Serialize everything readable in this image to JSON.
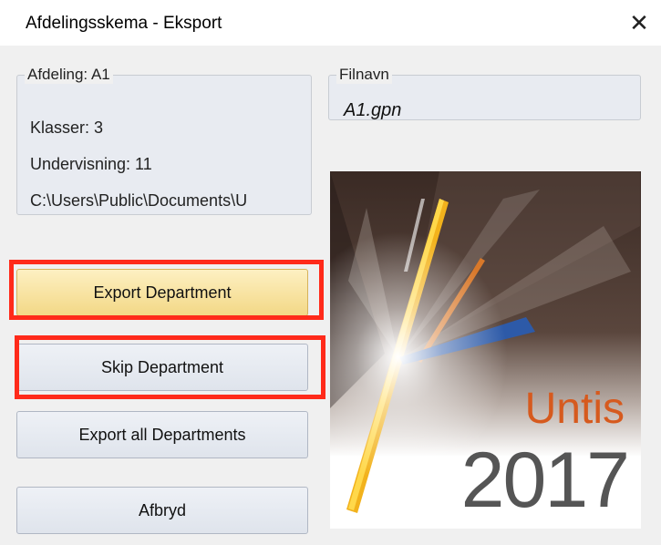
{
  "window": {
    "title": "Afdelingsskema - Eksport",
    "close_glyph": "✕"
  },
  "department_group": {
    "legend": "Afdeling: A1",
    "classes": "Klasser: 3",
    "lessons": "Undervisning: 11",
    "path": "C:\\Users\\Public\\Documents\\U"
  },
  "filename_group": {
    "legend": "Filnavn",
    "value": "A1.gpn"
  },
  "buttons": {
    "export_department": "Export Department",
    "skip_department": "Skip Department",
    "export_all": "Export all Departments",
    "cancel": "Afbryd"
  },
  "splash": {
    "product": "Untis",
    "year": "2017"
  },
  "colors": {
    "highlight": "#ff2a1a",
    "active_button": "#f3d886",
    "untis_orange": "#d65a1e"
  }
}
